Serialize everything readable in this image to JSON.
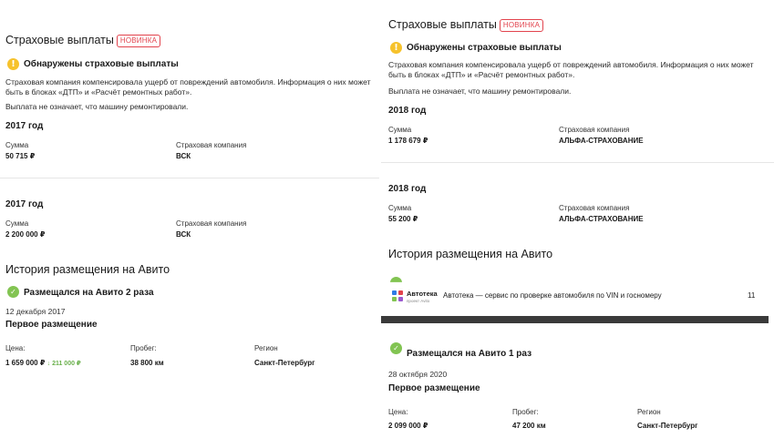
{
  "left": {
    "title": "Страховые выплаты",
    "badge": "НОВИНКА",
    "alert_title": "Обнаружены страховые выплаты",
    "alert_text_1": "Страховая компания компенсировала ущерб от повреждений автомобиля. Информация о них может",
    "alert_text_2": "быть в блоках «ДТП» и «Расчёт ремонтных работ».",
    "note": "Выплата не означает, что машину ремонтировали.",
    "payments": [
      {
        "year": "2017 год",
        "amount_label": "Сумма",
        "amount": "50 715 ₽",
        "company_label": "Страховая компания",
        "company": "ВСК"
      },
      {
        "year": "2017 год",
        "amount_label": "Сумма",
        "amount": "2 200 000 ₽",
        "company_label": "Страховая компания",
        "company": "ВСК"
      }
    ],
    "history_title": "История размещения на Авито",
    "placed": "Размещался на Авито 2 раза",
    "date": "12 декабря 2017",
    "first": "Первое размещение",
    "price_label": "Цена:",
    "price": "1 659 000 ₽",
    "price_drop": "↓ 211 000 ₽",
    "mileage_label": "Пробег:",
    "mileage": "38 800 км",
    "region_label": "Регион",
    "region": "Санкт-Петербург"
  },
  "right": {
    "title": "Страховые выплаты",
    "badge": "НОВИНКА",
    "alert_title": "Обнаружены страховые выплаты",
    "alert_text_1": "Страховая компания компенсировала ущерб от повреждений автомобиля. Информация о них может",
    "alert_text_2": "быть в блоках «ДТП» и «Расчёт ремонтных работ».",
    "note": "Выплата не означает, что машину ремонтировали.",
    "payments": [
      {
        "year": "2018 год",
        "amount_label": "Сумма",
        "amount": "1 178 679 ₽",
        "company_label": "Страховая компания",
        "company": "АЛЬФА-СТРАХОВАНИЕ"
      },
      {
        "year": "2018 год",
        "amount_label": "Сумма",
        "amount": "55 200 ₽",
        "company_label": "Страховая компания",
        "company": "АЛЬФА-СТРАХОВАНИЕ"
      }
    ],
    "history_title": "История размещения на Авито",
    "avtoteka": {
      "logo_name": "Автотека",
      "logo_sub": "проект Avito",
      "bar_text": "Автотека — сервис по проверке автомобиля по VIN и госномеру",
      "page_num": "11"
    },
    "placed": "Размещался на Авито 1 раз",
    "date": "28 октября 2020",
    "first": "Первое размещение",
    "price_label": "Цена:",
    "price": "2 099 000 ₽",
    "mileage_label": "Пробег:",
    "mileage": "47 200 км",
    "region_label": "Регион",
    "region": "Санкт-Петербург"
  },
  "colors": {
    "badge": "#e2434d",
    "warning": "#f6c22c",
    "success": "#82c452"
  }
}
